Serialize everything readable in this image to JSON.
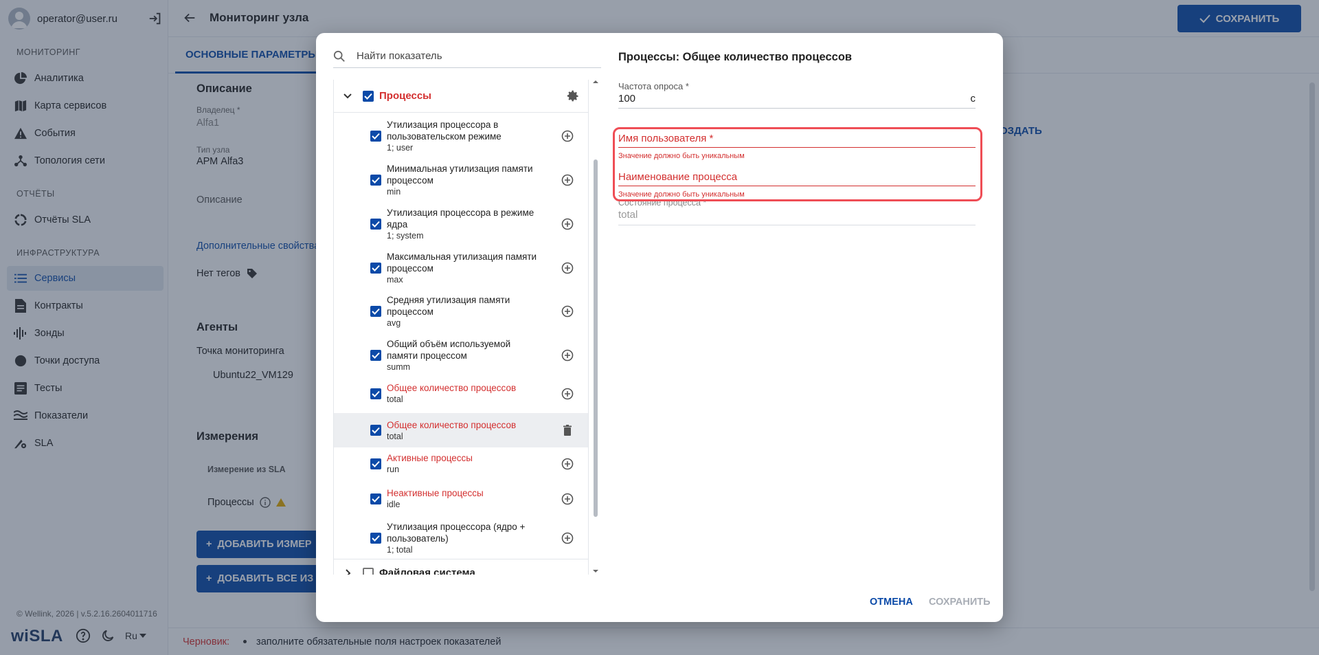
{
  "sidebar": {
    "user_email": "operator@user.ru",
    "sections": {
      "monitoring": "МОНИТОРИНГ",
      "reports": "ОТЧЁТЫ",
      "infrastructure": "ИНФРАСТРУКТУРА"
    },
    "items": {
      "analytics": "Аналитика",
      "service_map": "Карта сервисов",
      "events": "События",
      "topology": "Топология сети",
      "sla_reports": "Отчёты SLA",
      "services": "Сервисы",
      "contracts": "Контракты",
      "probes": "Зонды",
      "access_points": "Точки доступа",
      "tests": "Тесты",
      "indicators": "Показатели",
      "sla": "SLA"
    },
    "copyright": "© Wellink, 2026 | v.5.2.16.2604011716",
    "brand": "wiSLA",
    "lang": "Ru"
  },
  "header": {
    "title": "Мониторинг узла",
    "save_label": "СОХРАНИТЬ"
  },
  "tabs": {
    "main": "ОСНОВНЫЕ ПАРАМЕТРЫ"
  },
  "content": {
    "description_heading": "Описание",
    "owner_label": "Владелец *",
    "owner_value": "Alfa1",
    "node_type_label": "Тип узла",
    "node_type_value": "АРМ Alfa3",
    "description_placeholder": "Описание",
    "extra_props_link": "Дополнительные свойства",
    "no_tags": "Нет тегов",
    "agents_heading": "Агенты",
    "monitoring_point_label": "Точка мониторинга",
    "monitoring_point_value": "Ubuntu22_VM129",
    "measurements_heading": "Измерения",
    "sla_measure_col": "Измерение из SLA",
    "processes_row": "Процессы",
    "add_measure_btn": "ДОБАВИТЬ ИЗМЕР",
    "add_all_btn": "ДОБАВИТЬ ВСЕ ИЗ",
    "create_link": "ОЗДАТЬ"
  },
  "statusbar": {
    "draft_label": "Черновик:",
    "message": "заполните обязательные поля настроек показателей"
  },
  "modal": {
    "search_placeholder": "Найти показатель",
    "group_title": "Процессы",
    "items": [
      {
        "name": "Утилизация процессора в пользовательском режиме",
        "sub": "1; user",
        "error": false
      },
      {
        "name": "Минимальная утилизация памяти процессом",
        "sub": "min",
        "error": false
      },
      {
        "name": "Утилизация процессора в режиме ядра",
        "sub": "1; system",
        "error": false
      },
      {
        "name": "Максимальная утилизация памяти процессом",
        "sub": "max",
        "error": false
      },
      {
        "name": "Средняя утилизация памяти процессом",
        "sub": "avg",
        "error": false
      },
      {
        "name": "Общий объём используемой памяти процессом",
        "sub": "summ",
        "error": false
      },
      {
        "name": "Общее количество процессов",
        "sub": "total",
        "error": true
      },
      {
        "name": "Общее количество процессов",
        "sub": "total",
        "error": true
      },
      {
        "name": "Активные процессы",
        "sub": "run",
        "error": true
      },
      {
        "name": "Неактивные процессы",
        "sub": "idle",
        "error": true
      },
      {
        "name": "Утилизация процессора (ядро + пользователь)",
        "sub": "1; total",
        "error": false
      }
    ],
    "next_group_title": "Файловая система",
    "form_title": "Процессы: Общее количество процессов",
    "poll_label": "Частота опроса *",
    "poll_value": "100",
    "poll_unit": "с",
    "username_label": "Имя пользователя *",
    "username_hint": "Значение должно быть уникальным",
    "process_name_label": "Наименование процесса",
    "process_name_hint": "Значение должно быть уникальным",
    "state_label": "Состояние процесса *",
    "state_value": "total",
    "cancel_label": "ОТМЕНА",
    "save_label": "СОХРАНИТЬ",
    "colors": {
      "accent": "#0b4aa8",
      "error": "#d32f2f",
      "highlight": "#ef4d55"
    }
  }
}
